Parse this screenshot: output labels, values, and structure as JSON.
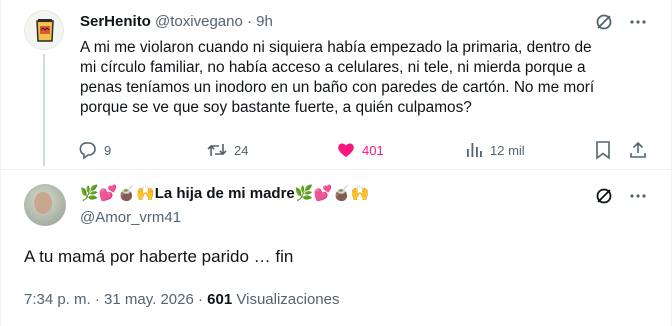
{
  "parent_tweet": {
    "display_name": "SerHenito",
    "handle": "@toxivegano",
    "separator": "·",
    "time": "9h",
    "text_lines": [
      "A mi me violaron cuando ni siquiera había empezado la primaria, dentro de",
      "mi círculo familiar, no había acceso a celulares, ni tele, ni mierda porque a",
      "penas teníamos un inodoro en un baño con paredes de cartón. No me morí",
      "porque se ve que soy bastante fuerte, a quién culpamos?"
    ],
    "replies_count": "9",
    "reposts_count": "24",
    "likes_count": "401",
    "views_count": "12 mil",
    "like_color": "#f91880"
  },
  "reply_tweet": {
    "display_name_prefix": "🌿💕🧉🙌",
    "display_name_core": "La hija de mi madre",
    "display_name_suffix": "🌿💕🧉🙌",
    "handle": "@Amor_vrm41",
    "text": "A tu mamá por haberte parido … fin",
    "time": "7:34 p. m.",
    "date_separator": "·",
    "date": "31 may. 2026",
    "meta_separator": "·",
    "views_number": "601",
    "views_label": "Visualizaciones"
  },
  "icons": [
    "grok-icon",
    "more-icon",
    "reply-icon",
    "repost-icon",
    "like-icon",
    "views-icon",
    "bookmark-icon",
    "share-icon"
  ],
  "colors": {
    "text": "#0f1419",
    "muted": "#536471",
    "accent_like": "#f91880",
    "border": "#eff3f4"
  }
}
